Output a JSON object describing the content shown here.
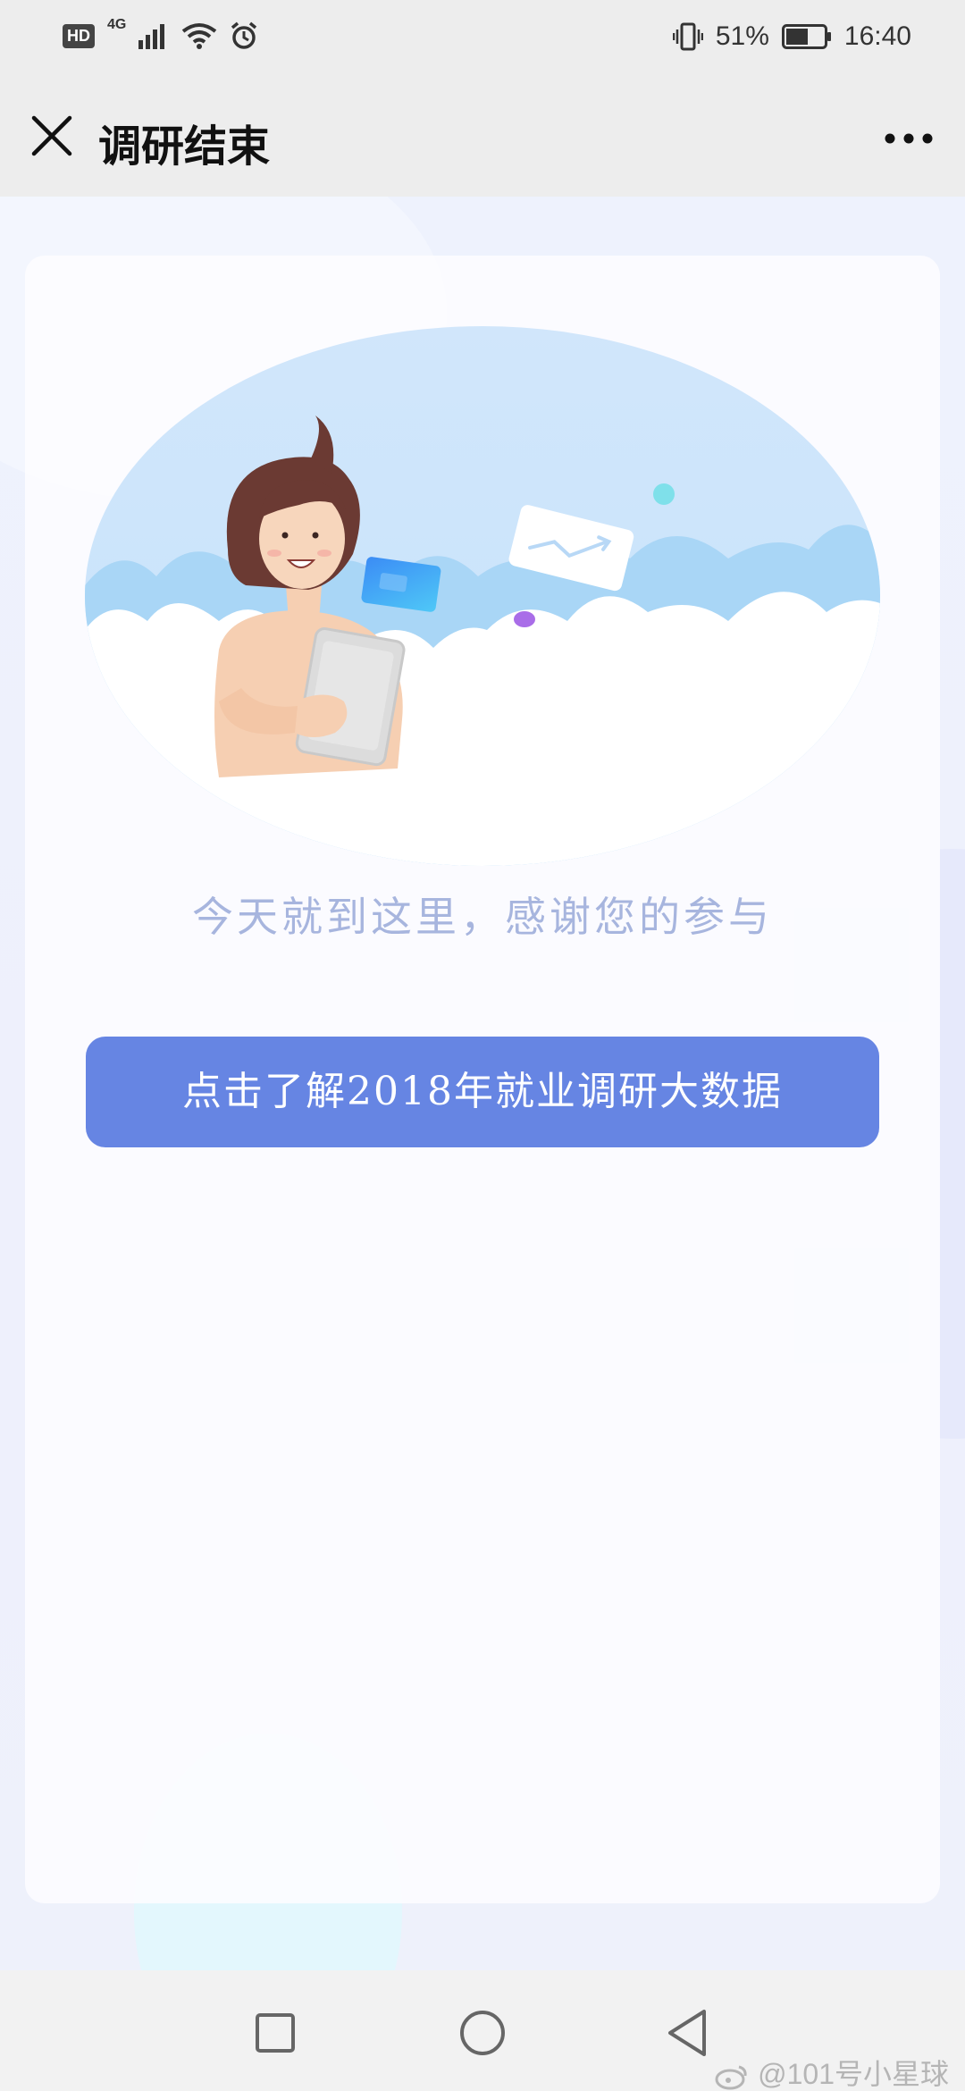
{
  "status_bar": {
    "hd": "HD",
    "network": "4G",
    "battery": "51%",
    "time": "16:40"
  },
  "header": {
    "title": "调研结束"
  },
  "main": {
    "thanks_text": "今天就到这里，感谢您的参与",
    "cta_label": "点击了解2018年就业调研大数据"
  },
  "watermark": "@101号小星球",
  "colors": {
    "button": "#6685e3",
    "thanks_text": "#a7b5de",
    "background": "#eef1fb"
  }
}
